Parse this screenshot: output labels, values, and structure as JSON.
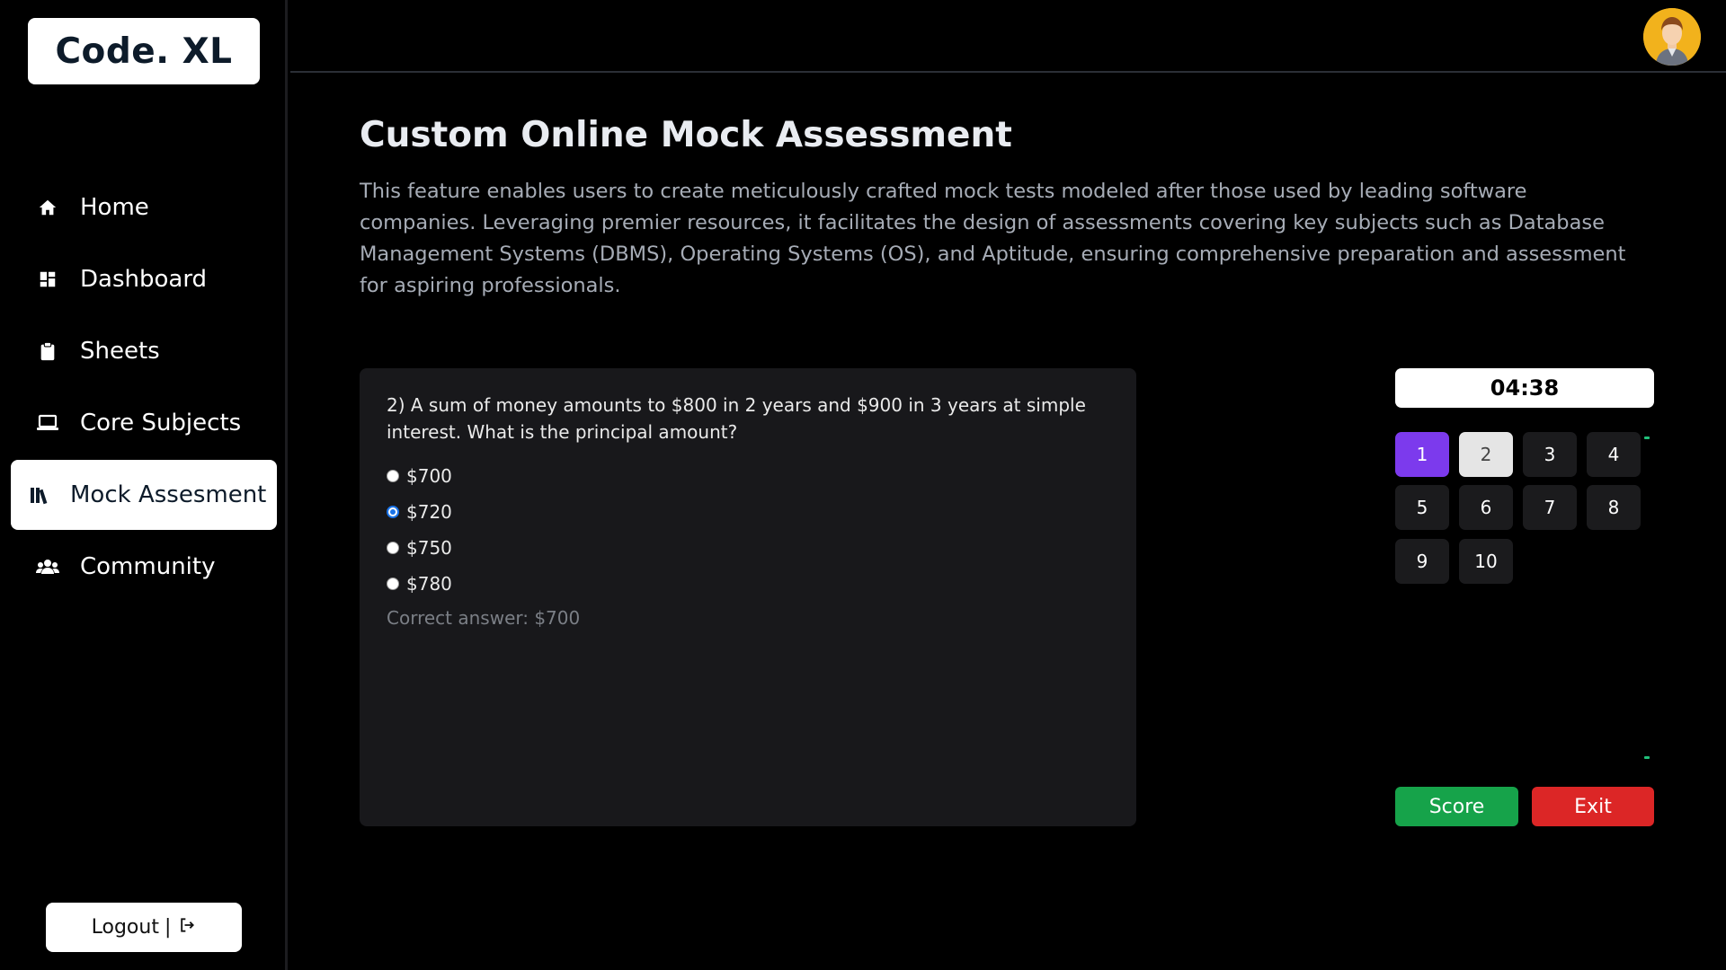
{
  "brand": {
    "logo_text": "Code. XL"
  },
  "sidebar": {
    "items": [
      {
        "label": "Home",
        "icon": "home-icon",
        "active": false
      },
      {
        "label": "Dashboard",
        "icon": "dashboard-icon",
        "active": false
      },
      {
        "label": "Sheets",
        "icon": "clipboard-icon",
        "active": false
      },
      {
        "label": "Core Subjects",
        "icon": "laptop-icon",
        "active": false
      },
      {
        "label": "Mock Assesment",
        "icon": "books-icon",
        "active": true
      },
      {
        "label": "Community",
        "icon": "users-icon",
        "active": false
      }
    ],
    "logout_label": "Logout",
    "logout_separator": "|"
  },
  "header": {
    "avatar_icon": "user-avatar-icon"
  },
  "main": {
    "title": "Custom Online Mock Assessment",
    "description": "This feature enables users to create meticulously crafted mock tests modeled after those used by leading software companies. Leveraging premier resources, it facilitates the design of assessments covering key subjects such as Database Management Systems (DBMS), Operating Systems (OS), and Aptitude, ensuring comprehensive preparation and assessment for aspiring professionals."
  },
  "question": {
    "text": "2) A sum of money amounts to $800 in 2 years and $900 in 3 years at simple interest. What is the principal amount?",
    "options": [
      "$700",
      "$720",
      "$750",
      "$780"
    ],
    "selected": "$720",
    "correct_answer_text": "Correct answer: $700"
  },
  "panel": {
    "timer": "04:38",
    "question_numbers": [
      "1",
      "2",
      "3",
      "4",
      "5",
      "6",
      "7",
      "8",
      "9",
      "10"
    ],
    "current": "1",
    "visited": [
      "2"
    ],
    "score_label": "Score",
    "exit_label": "Exit"
  },
  "colors": {
    "current_question": "#7c3aed",
    "score": "#16a34a",
    "exit": "#dc2626"
  }
}
